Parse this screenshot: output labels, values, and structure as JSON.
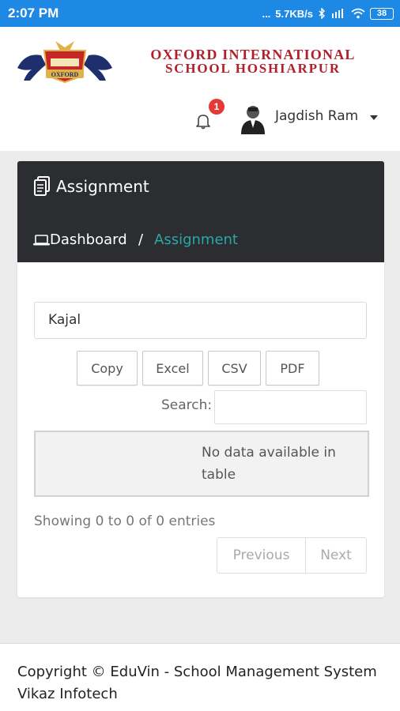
{
  "status_bar": {
    "time": "2:07 PM",
    "dots": "...",
    "network_speed": "5.7KB/s",
    "battery": "38"
  },
  "school": {
    "logo_text": "OXFORD",
    "name_line1": "OXFORD INTERNATIONAL",
    "name_line2": "SCHOOL HOSHIARPUR"
  },
  "topbar": {
    "notification_count": "1",
    "user_name": "Jagdish Ram"
  },
  "page": {
    "title": "Assignment",
    "breadcrumb": [
      {
        "label": "Dashboard"
      },
      {
        "label": "Assignment"
      }
    ],
    "breadcrumb_separator": "/"
  },
  "filter": {
    "student_value": "Kajal"
  },
  "export_buttons": [
    "Copy",
    "Excel",
    "CSV",
    "PDF"
  ],
  "search": {
    "label": "Search:",
    "value": ""
  },
  "table": {
    "empty_message": "No data available in table",
    "info": "Showing 0 to 0 of 0 entries"
  },
  "pagination": {
    "previous": "Previous",
    "next": "Next"
  },
  "footer": {
    "line1": "Copyright © EduVin - School Management System",
    "line2": "Vikaz Infotech"
  },
  "colors": {
    "status_bar": "#1e88e5",
    "card_header": "#2b2d30",
    "breadcrumb_active": "#2aa7a7",
    "school_name": "#b21f2a",
    "badge": "#e53935"
  },
  "icons": [
    "wifi-icon",
    "bluetooth-icon",
    "signal-icon",
    "battery-icon",
    "bell-icon",
    "user-avatar",
    "document-icon",
    "laptop-icon",
    "caret-down-icon"
  ]
}
